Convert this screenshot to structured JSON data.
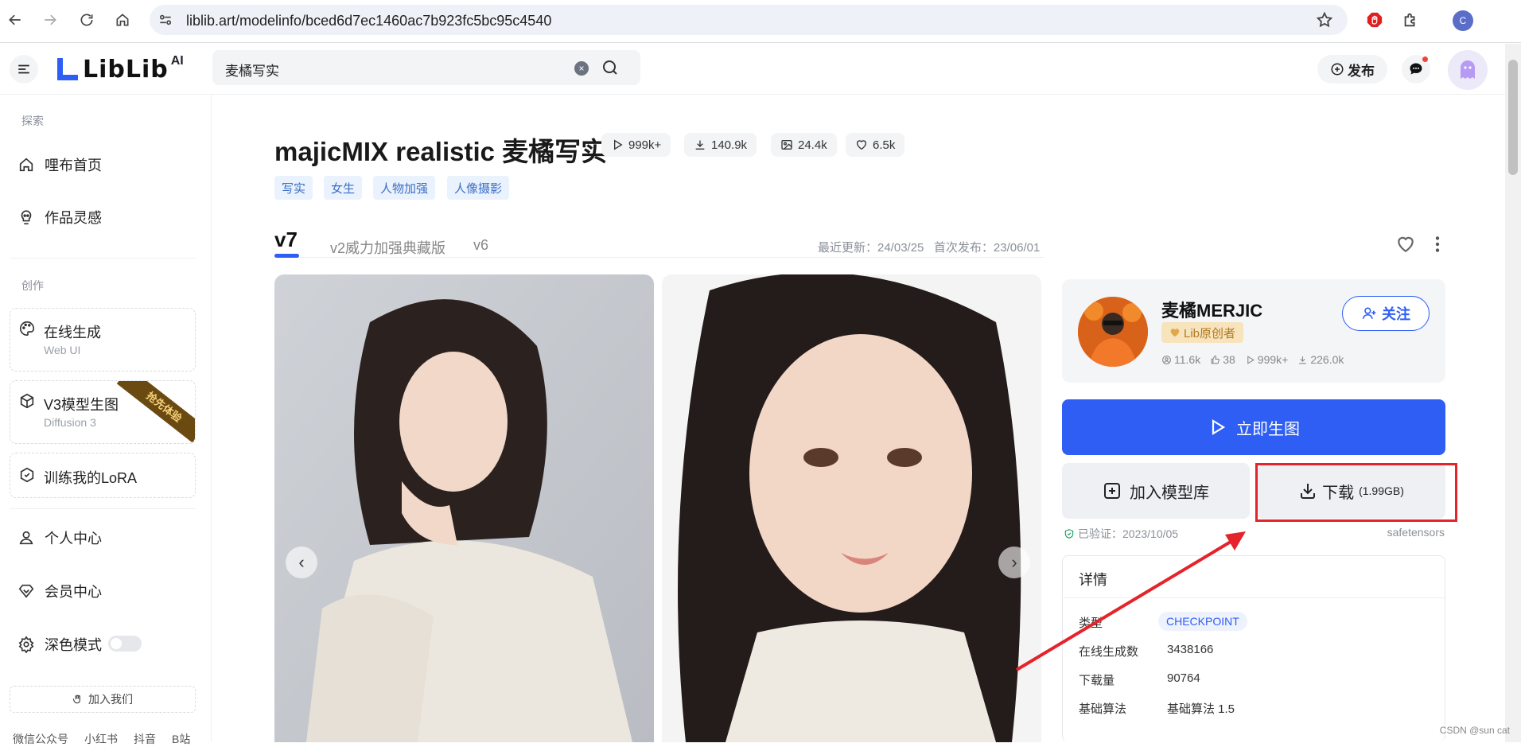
{
  "browser": {
    "url": "liblib.art/modelinfo/bced6d7ec1460ac7b923fc5bc95c4540",
    "profile_initial": "C",
    "icons": [
      "back-icon",
      "forward-icon",
      "reload-icon",
      "home-icon",
      "site-info-icon",
      "bookmark-star-icon",
      "adblock-extension-icon",
      "extensions-puzzle-icon"
    ]
  },
  "header": {
    "logo_text": "LibLib",
    "logo_suffix": "AI",
    "search_value": "麦橘写实",
    "publish_label": "发布"
  },
  "sidebar": {
    "explore_label": "探索",
    "explore_items": [
      {
        "label": "哩布首页",
        "icon": "home-outline-icon"
      },
      {
        "label": "作品灵感",
        "icon": "lightbulb-icon"
      }
    ],
    "create_label": "创作",
    "create_cards": [
      {
        "title": "在线生成",
        "subtitle": "Web UI",
        "icon": "palette-icon"
      },
      {
        "title": "V3模型生图",
        "subtitle": "Diffusion 3",
        "icon": "cube-icon",
        "ribbon": "抢先体验"
      }
    ],
    "train_label": "训练我的LoRA",
    "account_items": [
      {
        "label": "个人中心",
        "icon": "user-icon"
      },
      {
        "label": "会员中心",
        "icon": "diamond-icon"
      },
      {
        "label": "深色模式",
        "icon": "settings-icon"
      }
    ],
    "join_label": "加入我们",
    "social_links": [
      "微信公众号",
      "小红书",
      "抖音",
      "B站"
    ]
  },
  "model": {
    "title": "majicMIX realistic 麦橘写实",
    "stats": [
      {
        "icon": "play-icon",
        "value": "999k+"
      },
      {
        "icon": "download-icon",
        "value": "140.9k"
      },
      {
        "icon": "image-icon",
        "value": "24.4k"
      },
      {
        "icon": "heart-icon",
        "value": "6.5k"
      }
    ],
    "tags": [
      "写实",
      "女生",
      "人物加强",
      "人像摄影"
    ],
    "versions": [
      "v7",
      "v2威力加强典藏版",
      "v6"
    ],
    "updated": "最近更新：24/03/25",
    "published": "首次发布：23/06/01"
  },
  "creator": {
    "name": "麦橘MERJIC",
    "badge": "Lib原创者",
    "stats": [
      {
        "icon": "followers-icon",
        "value": "11.6k"
      },
      {
        "icon": "thumbs-up-icon",
        "value": "38"
      },
      {
        "icon": "play-icon",
        "value": "999k+"
      },
      {
        "icon": "download-icon",
        "value": "226.0k"
      }
    ],
    "follow_label": "关注"
  },
  "actions": {
    "generate_label": "立即生图",
    "add_library_label": "加入模型库",
    "download_label": "下载",
    "download_size": "(1.99GB)",
    "verified_text": "已验证：2023/10/05",
    "file_format": "safetensors"
  },
  "details": {
    "title": "详情",
    "type_label": "类型",
    "type_value": "CHECKPOINT",
    "rows": [
      {
        "label": "在线生成数",
        "value": "3438166"
      },
      {
        "label": "下载量",
        "value": "90764"
      },
      {
        "label": "基础算法",
        "value": "基础算法 1.5"
      }
    ]
  },
  "watermark": "CSDN @sun cat",
  "colors": {
    "primary": "#2f5ef5",
    "annotation_red": "#e5232b",
    "badge_gold": "#b07a1f"
  }
}
